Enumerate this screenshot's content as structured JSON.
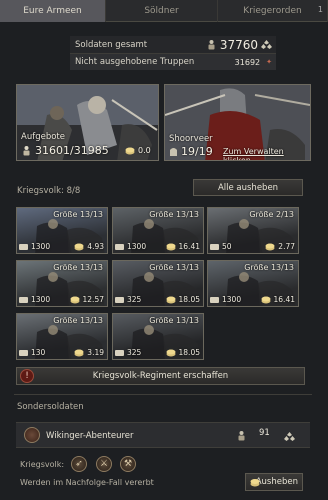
{
  "tabs": [
    {
      "label": "Eure Armeen"
    },
    {
      "label": "Söldner"
    },
    {
      "label": "Kriegerorden",
      "count": "1"
    }
  ],
  "summary": {
    "total_label": "Soldaten gesamt",
    "total_value": "37760",
    "unraised_label": "Nicht ausgehobene Truppen",
    "unraised_value": "31692"
  },
  "levies": {
    "label": "Aufgebote",
    "value": "31601/31985",
    "cost": "0.0"
  },
  "knights": {
    "label": "Shoorveer",
    "value": "19/19",
    "manage_link": "Zum Verwalten klicken"
  },
  "men_at_arms": {
    "title": "Kriegsvolk: 8/8",
    "raise_all_label": "Alle ausheben",
    "regiments": [
      {
        "size": "Größe 13/13",
        "soldiers": "1300",
        "cost": "4.93"
      },
      {
        "size": "Größe 13/13",
        "soldiers": "1300",
        "cost": "16.41"
      },
      {
        "size": "Größe 2/13",
        "soldiers": "50",
        "cost": "2.77"
      },
      {
        "size": "Größe 13/13",
        "soldiers": "1300",
        "cost": "12.57"
      },
      {
        "size": "Größe 13/13",
        "soldiers": "325",
        "cost": "18.05"
      },
      {
        "size": "Größe 13/13",
        "soldiers": "1300",
        "cost": "16.41"
      },
      {
        "size": "Größe 13/13",
        "soldiers": "130",
        "cost": "3.19"
      },
      {
        "size": "Größe 13/13",
        "soldiers": "325",
        "cost": "18.05"
      }
    ],
    "create_label": "Kriegsvolk-Regiment erschaffen"
  },
  "special": {
    "title": "Sondersoldaten",
    "name": "Wikinger-Abenteurer",
    "count": "91",
    "kriegsvolk_label": "Kriegsvolk:",
    "inherit_text": "Werden im Nachfolge-Fall vererbt",
    "raise_label": "Ausheben"
  },
  "colors": {
    "accent": "#c9a24a",
    "warning": "#7a2218",
    "panel": "#1d1f22"
  }
}
